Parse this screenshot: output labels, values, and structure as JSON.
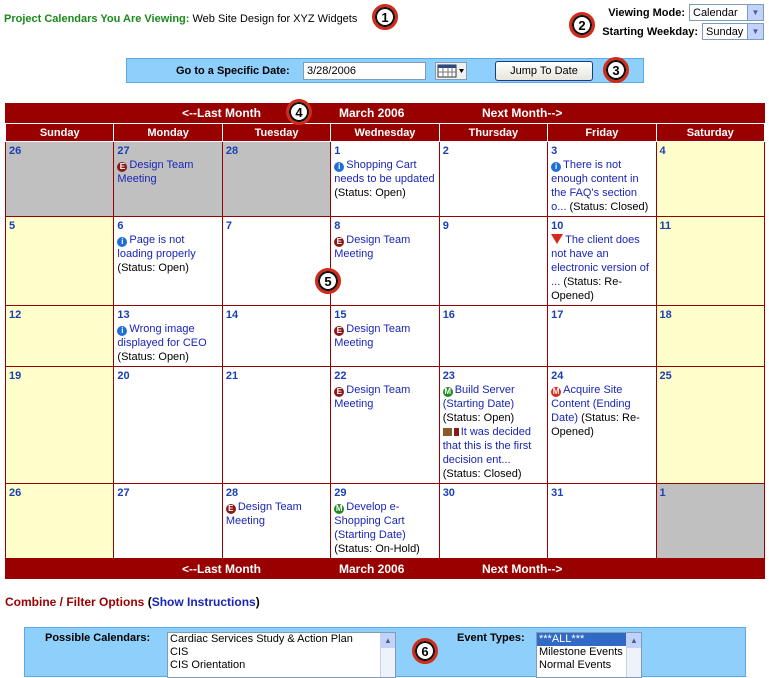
{
  "header": {
    "project_label": "Project Calendars You Are Viewing:",
    "project_name": "Web Site Design for XYZ Widgets",
    "viewing_mode_label": "Viewing Mode:",
    "viewing_mode_value": "Calendar",
    "starting_weekday_label": "Starting Weekday:",
    "starting_weekday_value": "Sunday"
  },
  "goto": {
    "label": "Go to a Specific Date:",
    "date_value": "3/28/2006",
    "jump_button": "Jump To Date"
  },
  "nav": {
    "last_month": "<--Last Month",
    "current_month": "March 2006",
    "next_month": "Next Month-->"
  },
  "weekdays": [
    "Sunday",
    "Monday",
    "Tuesday",
    "Wednesday",
    "Thursday",
    "Friday",
    "Saturday"
  ],
  "weeks": [
    [
      {
        "day": "26",
        "type": "other",
        "events": []
      },
      {
        "day": "27",
        "type": "other",
        "events": [
          {
            "icon": "e",
            "text": "Design Team Meeting",
            "status": ""
          }
        ]
      },
      {
        "day": "28",
        "type": "other",
        "events": []
      },
      {
        "day": "1",
        "type": "normal",
        "events": [
          {
            "icon": "i",
            "text": "Shopping Cart needs to be updated",
            "status": "(Status: Open)"
          }
        ]
      },
      {
        "day": "2",
        "type": "normal",
        "events": []
      },
      {
        "day": "3",
        "type": "normal",
        "events": [
          {
            "icon": "i",
            "text": "There is not enough content in the FAQ's section o...",
            "status": "(Status: Closed)"
          }
        ]
      },
      {
        "day": "4",
        "type": "wk",
        "events": []
      }
    ],
    [
      {
        "day": "5",
        "type": "wk",
        "events": []
      },
      {
        "day": "6",
        "type": "normal",
        "events": [
          {
            "icon": "i",
            "text": "Page is not loading properly",
            "status": "(Status: Open)"
          }
        ]
      },
      {
        "day": "7",
        "type": "normal",
        "events": []
      },
      {
        "day": "8",
        "type": "normal",
        "events": [
          {
            "icon": "e",
            "text": "Design Team Meeting",
            "status": ""
          }
        ]
      },
      {
        "day": "9",
        "type": "normal",
        "events": []
      },
      {
        "day": "10",
        "type": "normal",
        "events": [
          {
            "icon": "tri",
            "text": "The client does not have an electronic version of ...",
            "status": "(Status: Re-Opened)"
          }
        ]
      },
      {
        "day": "11",
        "type": "wk",
        "events": []
      }
    ],
    [
      {
        "day": "12",
        "type": "wk",
        "events": []
      },
      {
        "day": "13",
        "type": "normal",
        "events": [
          {
            "icon": "i",
            "text": "Wrong image displayed for CEO",
            "status": "(Status: Open)"
          }
        ]
      },
      {
        "day": "14",
        "type": "normal",
        "events": []
      },
      {
        "day": "15",
        "type": "normal",
        "events": [
          {
            "icon": "e",
            "text": "Design Team Meeting",
            "status": ""
          }
        ]
      },
      {
        "day": "16",
        "type": "normal",
        "events": []
      },
      {
        "day": "17",
        "type": "normal",
        "events": []
      },
      {
        "day": "18",
        "type": "wk",
        "events": []
      }
    ],
    [
      {
        "day": "19",
        "type": "wk",
        "events": []
      },
      {
        "day": "20",
        "type": "normal",
        "events": []
      },
      {
        "day": "21",
        "type": "normal",
        "events": []
      },
      {
        "day": "22",
        "type": "normal",
        "events": [
          {
            "icon": "e",
            "text": "Design Team Meeting",
            "status": ""
          }
        ]
      },
      {
        "day": "23",
        "type": "normal",
        "events": [
          {
            "icon": "m",
            "text": "Build Server (Starting Date)",
            "status": "(Status: Open)"
          },
          {
            "icon": "gav",
            "text": "It was decided that this is the first decision ent...",
            "status": "(Status: Closed)"
          }
        ]
      },
      {
        "day": "24",
        "type": "normal",
        "events": [
          {
            "icon": "mr",
            "text": "Acquire Site Content (Ending Date)",
            "status": "(Status: Re-Opened)"
          }
        ]
      },
      {
        "day": "25",
        "type": "wk",
        "events": []
      }
    ],
    [
      {
        "day": "26",
        "type": "wk",
        "events": []
      },
      {
        "day": "27",
        "type": "normal",
        "events": []
      },
      {
        "day": "28",
        "type": "normal",
        "events": [
          {
            "icon": "e",
            "text": "Design Team Meeting",
            "status": ""
          }
        ]
      },
      {
        "day": "29",
        "type": "normal",
        "events": [
          {
            "icon": "m",
            "text": "Develop e-Shopping Cart (Starting Date)",
            "status": "(Status: On-Hold)"
          }
        ]
      },
      {
        "day": "30",
        "type": "normal",
        "events": []
      },
      {
        "day": "31",
        "type": "normal",
        "events": []
      },
      {
        "day": "1",
        "type": "other",
        "events": []
      }
    ]
  ],
  "filter": {
    "title": "Combine / Filter Options",
    "open_paren": "(",
    "show_instructions": "Show Instructions",
    "close_paren": ")",
    "possible_calendars_label": "Possible Calendars:",
    "calendars": [
      "Cardiac Services Study & Action Plan",
      "CIS",
      "CIS Orientation"
    ],
    "event_types_label": "Event Types:",
    "event_types": [
      "***ALL***",
      "Milestone Events",
      "Normal Events"
    ]
  },
  "callouts": [
    "1",
    "2",
    "3",
    "4",
    "5",
    "6"
  ],
  "icon_legend": {
    "i": "info-icon",
    "e": "event-icon",
    "m": "milestone-icon",
    "mr": "milestone-red-icon",
    "tri": "warning-triangle-icon",
    "gav": "gavel-icon"
  }
}
